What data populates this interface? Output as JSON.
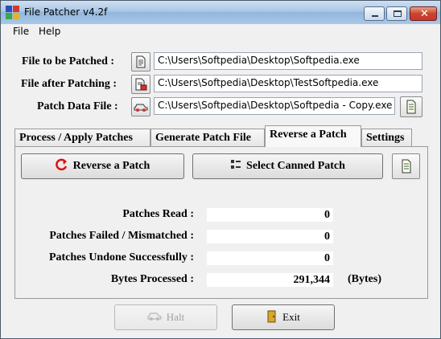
{
  "window": {
    "title": "File Patcher v4.2f",
    "icon": "file-patcher-app-icon",
    "controls": {
      "minimize": "minimize-icon",
      "maximize": "maximize-icon",
      "close": "close-icon"
    }
  },
  "menu": {
    "items": [
      {
        "label": "File"
      },
      {
        "label": "Help"
      }
    ]
  },
  "files": {
    "to_patch": {
      "label": "File to be Patched :",
      "value": "C:\\Users\\Softpedia\\Desktop\\Softpedia.exe",
      "icon": "document-icon"
    },
    "after_patch": {
      "label": "File after Patching :",
      "value": "C:\\Users\\Softpedia\\Desktop\\TestSoftpedia.exe",
      "icon": "patched-document-icon"
    },
    "patch_data": {
      "label": "Patch Data File :",
      "value": "C:\\Users\\Softpedia\\Desktop\\Softpedia - Copy.exe",
      "icon": "patch-car-icon"
    },
    "patch_data_extra_icon": "open-patch-file-icon"
  },
  "tabs": [
    {
      "label": "Process / Apply Patches",
      "active": false
    },
    {
      "label": "Generate Patch File",
      "active": false
    },
    {
      "label": "Reverse a Patch",
      "active": true
    },
    {
      "label": "Settings",
      "active": false
    }
  ],
  "reverse": {
    "reverse_button": "Reverse a Patch",
    "canned_button": "Select Canned Patch",
    "stats": [
      {
        "label": "Patches Read :",
        "value": "0",
        "unit": ""
      },
      {
        "label": "Patches Failed / Mismatched :",
        "value": "0",
        "unit": ""
      },
      {
        "label": "Patches Undone Successfully :",
        "value": "0",
        "unit": ""
      },
      {
        "label": "Bytes Processed :",
        "value": "291,344",
        "unit": "(Bytes)"
      }
    ]
  },
  "footer": {
    "halt_label": "Halt",
    "halt_enabled": false,
    "exit_label": "Exit"
  },
  "colors": {
    "title_gradient_mid": "#93b6dc",
    "close_red": "#c9452a",
    "face": "#f0f0f0"
  }
}
